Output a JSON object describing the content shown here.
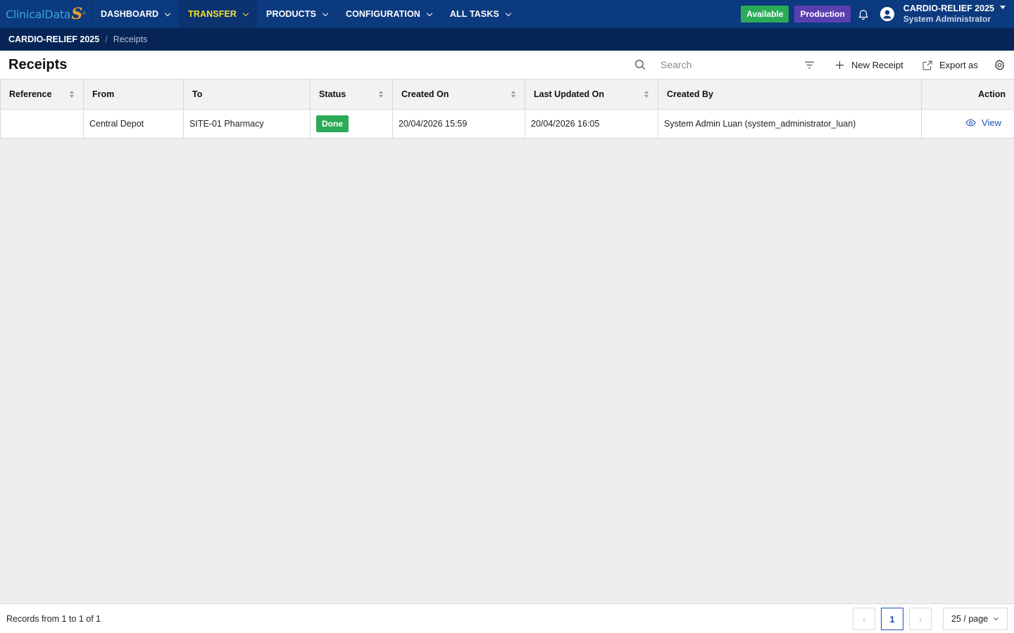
{
  "brand": {
    "logo_text": "ClinicalData",
    "logo_mark": "S",
    "logo_reg": "®"
  },
  "nav": {
    "items": [
      {
        "label": "DASHBOARD"
      },
      {
        "label": "TRANSFER",
        "active": true
      },
      {
        "label": "PRODUCTS"
      },
      {
        "label": "CONFIGURATION"
      },
      {
        "label": "ALL TASKS"
      }
    ],
    "available_badge": "Available",
    "production_badge": "Production",
    "user_study": "CARDIO-RELIEF 2025",
    "user_role": "System Administrator"
  },
  "breadcrumb": {
    "study": "CARDIO-RELIEF 2025",
    "separator": "/",
    "current": "Receipts"
  },
  "page": {
    "title": "Receipts",
    "search_placeholder": "Search",
    "new_label": "New Receipt",
    "export_label": "Export as"
  },
  "table": {
    "columns": [
      "Reference",
      "From",
      "To",
      "Status",
      "Created On",
      "Last Updated On",
      "Created By",
      "Action"
    ],
    "rows": [
      {
        "reference": "",
        "from": "Central Depot",
        "to": "SITE-01 Pharmacy",
        "status": "Done",
        "created_on": "20/04/2026 15:59",
        "last_updated_on": "20/04/2026 16:05",
        "created_by": "System Admin Luan (system_administrator_luan)",
        "action": "View"
      }
    ]
  },
  "footer": {
    "records": "Records from 1 to 1 of 1",
    "prev": "‹",
    "current_page": "1",
    "next": "›",
    "page_size": "25 / page"
  },
  "colors": {
    "nav_bg": "#0b3a7e",
    "crumb_bg": "#062556",
    "active_nav_text": "#f5e02e",
    "success": "#2bab58",
    "production": "#5b3fb0",
    "link": "#1a52b8"
  }
}
